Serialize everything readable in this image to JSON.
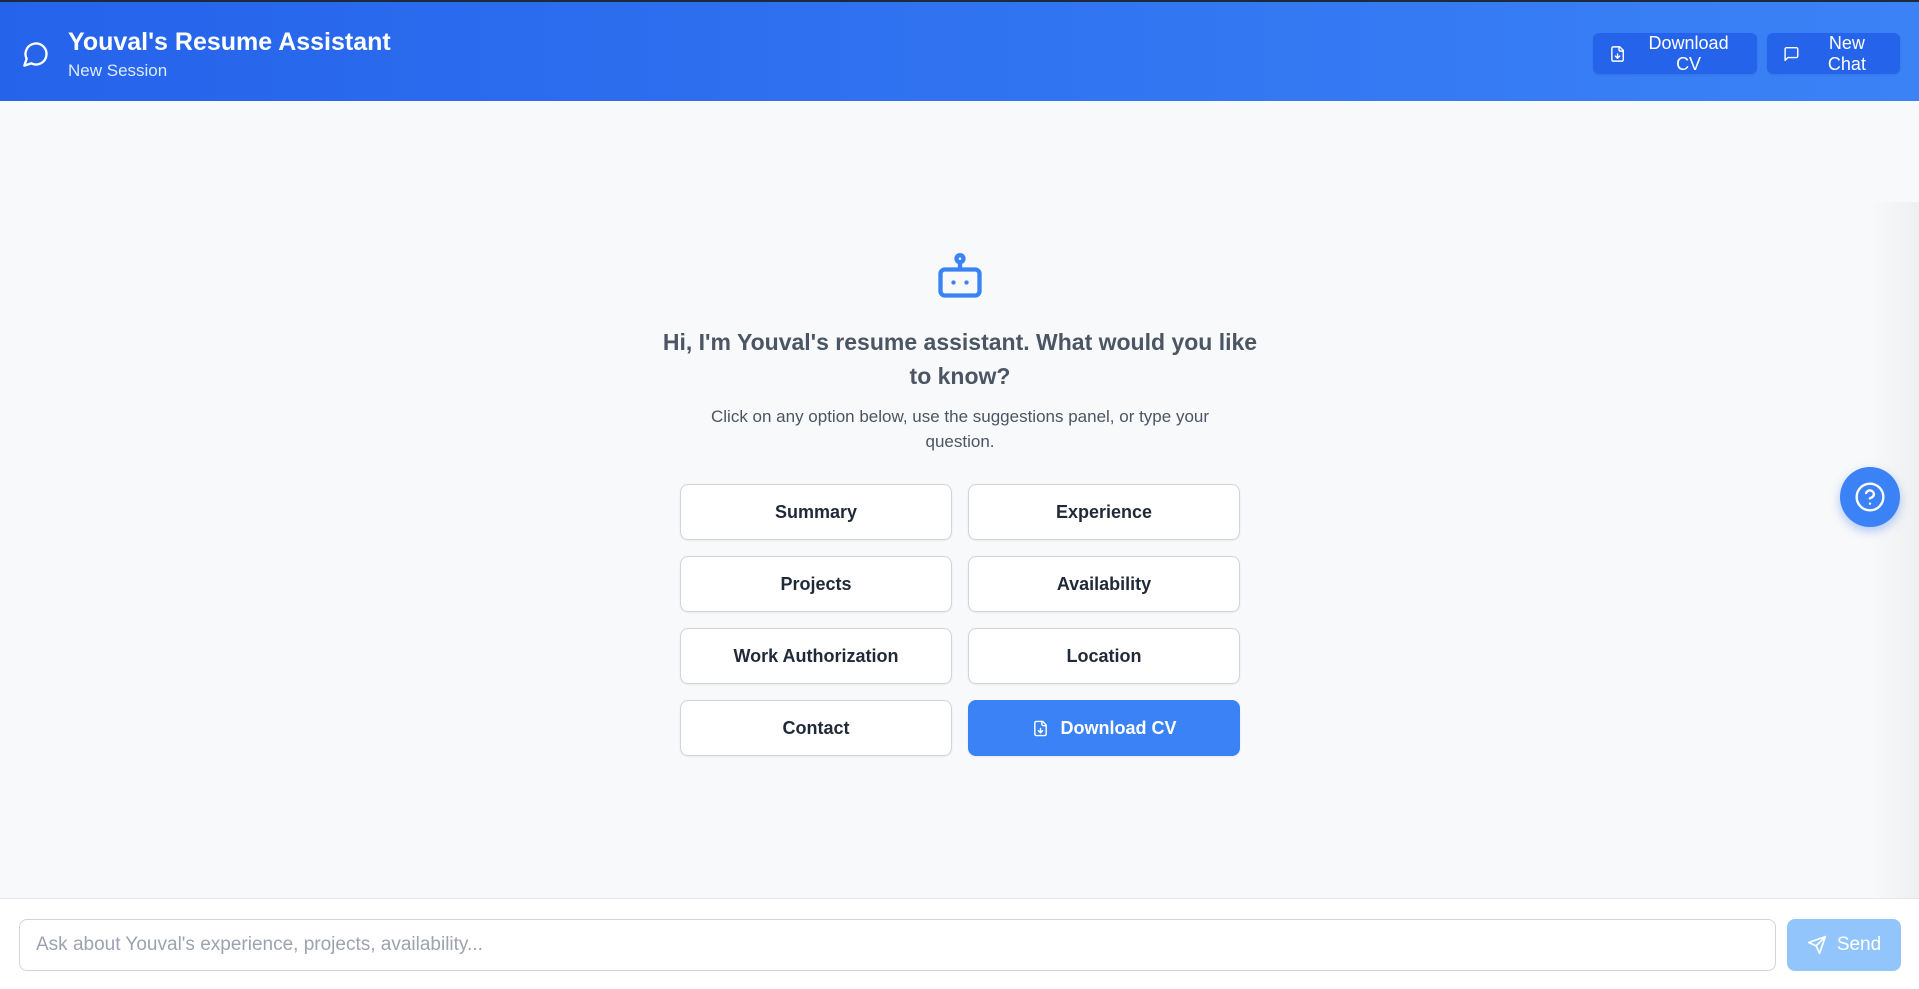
{
  "header": {
    "title": "Youval's Resume Assistant",
    "subtitle": "New Session",
    "download_label": "Download CV",
    "new_chat_label": "New Chat",
    "icons": {
      "logo": "chat-bubble-icon",
      "download": "file-download-icon",
      "new_chat": "message-square-icon"
    }
  },
  "welcome": {
    "icon": "robot-icon",
    "title": "Hi, I'm Youval's resume assistant. What would you like to know?",
    "subtitle": "Click on any option below, use the suggestions panel, or type your question.",
    "options": [
      {
        "label": "Summary"
      },
      {
        "label": "Experience"
      },
      {
        "label": "Projects"
      },
      {
        "label": "Availability"
      },
      {
        "label": "Work Authorization"
      },
      {
        "label": "Location"
      },
      {
        "label": "Contact"
      },
      {
        "label": "Download CV",
        "icon": "file-download-icon",
        "primary": true
      }
    ]
  },
  "help": {
    "icon": "question-circle-icon"
  },
  "input": {
    "placeholder": "Ask about Youval's experience, projects, availability...",
    "value": "",
    "send_label": "Send",
    "send_icon": "send-icon"
  },
  "colors": {
    "header_start": "#2563eb",
    "header_end": "#3b82f6",
    "accent": "#3b82f6",
    "send_disabled": "#93c5fd",
    "background": "#f8f9fa"
  }
}
